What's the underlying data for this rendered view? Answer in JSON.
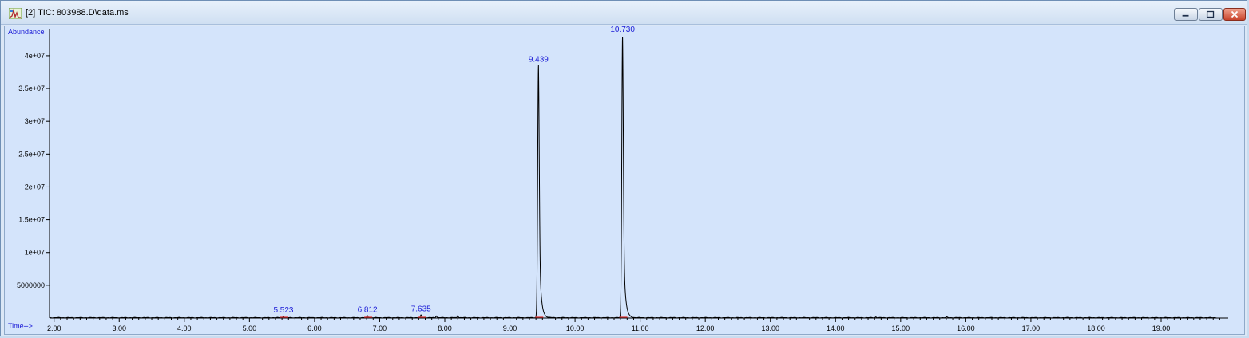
{
  "window": {
    "title": "[2] TIC: 803988.D\\data.ms",
    "buttons": {
      "minimize": "minimize",
      "maximize": "maximize",
      "close": "close"
    }
  },
  "colors": {
    "plot_bg": "#d4e4fb",
    "trace": "#000000",
    "label": "#1a1ad6",
    "baseline_marker": "#e03030"
  },
  "chart_data": {
    "type": "line",
    "title": "",
    "xlabel": "Time-->",
    "ylabel": "Abundance",
    "xlim": [
      1.93,
      20.03
    ],
    "ylim": [
      0,
      44000000
    ],
    "xticks": [
      "2.00",
      "3.00",
      "4.00",
      "5.00",
      "6.00",
      "7.00",
      "8.00",
      "9.00",
      "10.00",
      "11.00",
      "12.00",
      "13.00",
      "14.00",
      "15.00",
      "16.00",
      "17.00",
      "18.00",
      "19.00"
    ],
    "xtick_values": [
      2,
      3,
      4,
      5,
      6,
      7,
      8,
      9,
      10,
      11,
      12,
      13,
      14,
      15,
      16,
      17,
      18,
      19
    ],
    "yticks": [
      "5000000",
      "1e+07",
      "1.5e+07",
      "2e+07",
      "2.5e+07",
      "3e+07",
      "3.5e+07",
      "4e+07"
    ],
    "ytick_values": [
      5000000,
      10000000,
      15000000,
      20000000,
      25000000,
      30000000,
      35000000,
      40000000
    ],
    "peak_labels": [
      "5.523",
      "6.812",
      "7.635",
      "9.439",
      "10.730"
    ],
    "peaks": [
      {
        "rt": 5.523,
        "height": 250000
      },
      {
        "rt": 6.812,
        "height": 300000
      },
      {
        "rt": 7.635,
        "height": 400000
      },
      {
        "rt": 9.439,
        "height": 38500000
      },
      {
        "rt": 10.73,
        "height": 43000000
      }
    ],
    "minor_peaks": [
      {
        "rt": 7.87,
        "height": 300000
      },
      {
        "rt": 8.2,
        "height": 350000
      },
      {
        "rt": 14.62,
        "height": 120000
      },
      {
        "rt": 15.71,
        "height": 80000
      }
    ],
    "grid": false
  }
}
